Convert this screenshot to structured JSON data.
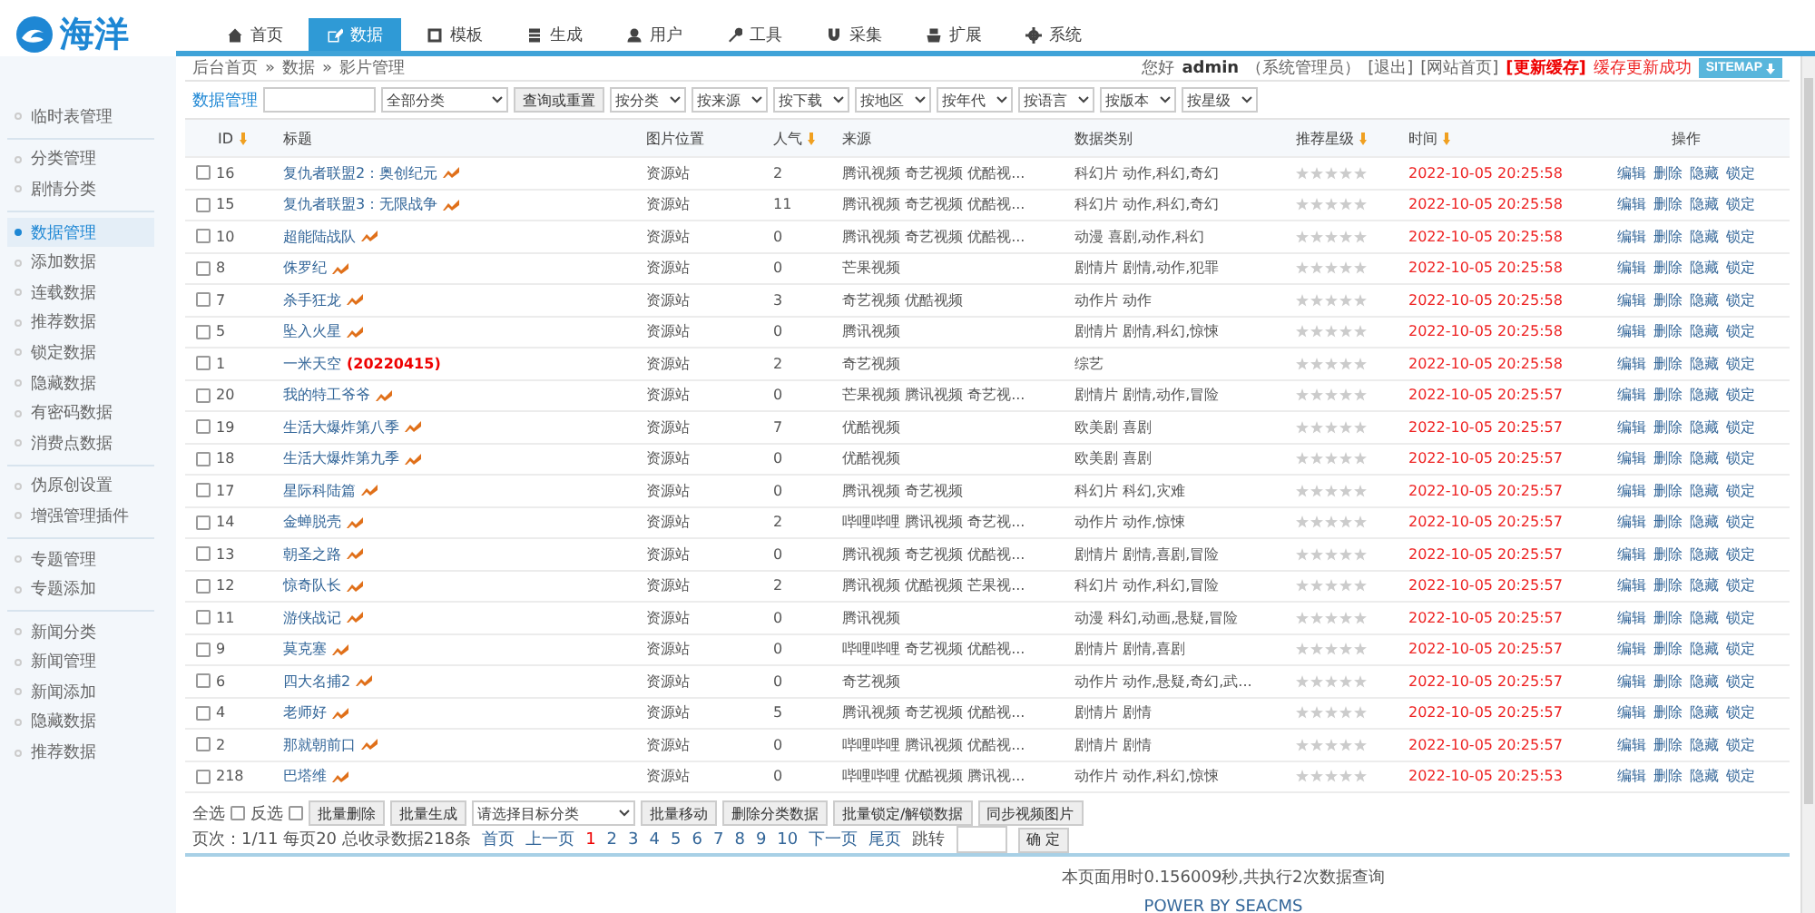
{
  "logo": {
    "text": "海洋"
  },
  "nav": [
    {
      "label": "首页",
      "selected": false
    },
    {
      "label": "数据",
      "selected": true
    },
    {
      "label": "模板",
      "selected": false
    },
    {
      "label": "生成",
      "selected": false
    },
    {
      "label": "用户",
      "selected": false
    },
    {
      "label": "工具",
      "selected": false
    },
    {
      "label": "采集",
      "selected": false
    },
    {
      "label": "扩展",
      "selected": false
    },
    {
      "label": "系统",
      "selected": false
    }
  ],
  "breadcrumb": [
    "后台首页",
    "»",
    "数据",
    "»",
    "影片管理"
  ],
  "user_bar": {
    "greeting": "您好",
    "user": "admin",
    "role": "（系统管理员）",
    "logout": "[退出]",
    "home": "[网站首页]",
    "cache": "[更新缓存]",
    "cache_status": "缓存更新成功",
    "sitemap": "SITEMAP"
  },
  "sidebar": {
    "groups": [
      {
        "items": [
          {
            "label": "临时表管理",
            "selected": false
          }
        ]
      },
      {
        "items": [
          {
            "label": "分类管理",
            "selected": false
          },
          {
            "label": "剧情分类",
            "selected": false
          }
        ]
      },
      {
        "items": [
          {
            "label": "数据管理",
            "selected": true
          },
          {
            "label": "添加数据",
            "selected": false
          },
          {
            "label": "连载数据",
            "selected": false
          },
          {
            "label": "推荐数据",
            "selected": false
          },
          {
            "label": "锁定数据",
            "selected": false
          },
          {
            "label": "隐藏数据",
            "selected": false
          },
          {
            "label": "有密码数据",
            "selected": false
          },
          {
            "label": "消费点数据",
            "selected": false
          }
        ]
      },
      {
        "items": [
          {
            "label": "伪原创设置",
            "selected": false
          },
          {
            "label": "增强管理插件",
            "selected": false
          }
        ]
      },
      {
        "items": [
          {
            "label": "专题管理",
            "selected": false
          },
          {
            "label": "专题添加",
            "selected": false
          }
        ]
      },
      {
        "items": [
          {
            "label": "新闻分类",
            "selected": false
          },
          {
            "label": "新闻管理",
            "selected": false
          },
          {
            "label": "新闻添加",
            "selected": false
          },
          {
            "label": "隐藏数据",
            "selected": false
          },
          {
            "label": "推荐数据",
            "selected": false
          }
        ]
      }
    ]
  },
  "filter": {
    "label": "数据管理",
    "category": "全部分类",
    "query_button": "查询或重置",
    "selects": [
      "按分类",
      "按来源",
      "按下载",
      "按地区",
      "按年代",
      "按语言",
      "按版本",
      "按星级"
    ]
  },
  "table": {
    "columns": [
      {
        "label": "ID",
        "sortable": true
      },
      {
        "label": "标题",
        "sortable": false
      },
      {
        "label": "图片位置",
        "sortable": false
      },
      {
        "label": "人气",
        "sortable": true
      },
      {
        "label": "来源",
        "sortable": false
      },
      {
        "label": "数据类别",
        "sortable": false
      },
      {
        "label": "推荐星级",
        "sortable": true
      },
      {
        "label": "时间",
        "sortable": true
      },
      {
        "label": "操作",
        "sortable": false
      }
    ],
    "rows": [
      {
        "checked": false,
        "id": "16",
        "title": "复仇者联盟2：奥创纪元",
        "hot": true,
        "pic": "资源站",
        "views": "2",
        "source": "腾讯视频 奇艺视频 优酷视...",
        "category": "科幻片 动作,科幻,奇幻",
        "stars": 0,
        "time": "2022-10-05 20:25:58",
        "actions": [
          "编辑",
          "删除",
          "隐藏",
          "锁定"
        ]
      },
      {
        "checked": false,
        "id": "15",
        "title": "复仇者联盟3：无限战争",
        "hot": true,
        "pic": "资源站",
        "views": "11",
        "source": "腾讯视频 奇艺视频 优酷视...",
        "category": "科幻片 动作,科幻,奇幻",
        "stars": 0,
        "time": "2022-10-05 20:25:58",
        "actions": [
          "编辑",
          "删除",
          "隐藏",
          "锁定"
        ]
      },
      {
        "checked": false,
        "id": "10",
        "title": "超能陆战队",
        "hot": true,
        "pic": "资源站",
        "views": "0",
        "source": "腾讯视频 奇艺视频 优酷视...",
        "category": "动漫 喜剧,动作,科幻",
        "stars": 0,
        "time": "2022-10-05 20:25:58",
        "actions": [
          "编辑",
          "删除",
          "隐藏",
          "锁定"
        ]
      },
      {
        "checked": false,
        "id": "8",
        "title": "侏罗纪",
        "hot": true,
        "pic": "资源站",
        "views": "0",
        "source": "芒果视频",
        "category": "剧情片 剧情,动作,犯罪",
        "stars": 0,
        "time": "2022-10-05 20:25:58",
        "actions": [
          "编辑",
          "删除",
          "隐藏",
          "锁定"
        ]
      },
      {
        "checked": false,
        "id": "7",
        "title": "杀手狂龙",
        "hot": true,
        "pic": "资源站",
        "views": "3",
        "source": "奇艺视频 优酷视频",
        "category": "动作片 动作",
        "stars": 0,
        "time": "2022-10-05 20:25:58",
        "actions": [
          "编辑",
          "删除",
          "隐藏",
          "锁定"
        ]
      },
      {
        "checked": false,
        "id": "5",
        "title": "坠入火星",
        "hot": true,
        "pic": "资源站",
        "views": "0",
        "source": "腾讯视频",
        "category": "剧情片 剧情,科幻,惊悚",
        "stars": 0,
        "time": "2022-10-05 20:25:58",
        "actions": [
          "编辑",
          "删除",
          "隐藏",
          "锁定"
        ]
      },
      {
        "checked": false,
        "id": "1",
        "title": "一米天空",
        "note": "(20220415)",
        "hot": false,
        "pic": "资源站",
        "views": "2",
        "source": "奇艺视频",
        "category": "综艺",
        "stars": 0,
        "time": "2022-10-05 20:25:58",
        "actions": [
          "编辑",
          "删除",
          "隐藏",
          "锁定"
        ]
      },
      {
        "checked": false,
        "id": "20",
        "title": "我的特工爷爷",
        "hot": true,
        "pic": "资源站",
        "views": "0",
        "source": "芒果视频 腾讯视频 奇艺视...",
        "category": "剧情片 剧情,动作,冒险",
        "stars": 0,
        "time": "2022-10-05 20:25:57",
        "actions": [
          "编辑",
          "删除",
          "隐藏",
          "锁定"
        ]
      },
      {
        "checked": false,
        "id": "19",
        "title": "生活大爆炸第八季",
        "hot": true,
        "pic": "资源站",
        "views": "7",
        "source": "优酷视频",
        "category": "欧美剧 喜剧",
        "stars": 0,
        "time": "2022-10-05 20:25:57",
        "actions": [
          "编辑",
          "删除",
          "隐藏",
          "锁定"
        ]
      },
      {
        "checked": false,
        "id": "18",
        "title": "生活大爆炸第九季",
        "hot": true,
        "pic": "资源站",
        "views": "0",
        "source": "优酷视频",
        "category": "欧美剧 喜剧",
        "stars": 0,
        "time": "2022-10-05 20:25:57",
        "actions": [
          "编辑",
          "删除",
          "隐藏",
          "锁定"
        ]
      },
      {
        "checked": false,
        "id": "17",
        "title": "星际科陆篇",
        "hot": true,
        "pic": "资源站",
        "views": "0",
        "source": "腾讯视频 奇艺视频",
        "category": "科幻片 科幻,灾难",
        "stars": 0,
        "time": "2022-10-05 20:25:57",
        "actions": [
          "编辑",
          "删除",
          "隐藏",
          "锁定"
        ]
      },
      {
        "checked": false,
        "id": "14",
        "title": "金蝉脱壳",
        "hot": true,
        "pic": "资源站",
        "views": "2",
        "source": "哔哩哔哩 腾讯视频 奇艺视...",
        "category": "动作片 动作,惊悚",
        "stars": 0,
        "time": "2022-10-05 20:25:57",
        "actions": [
          "编辑",
          "删除",
          "隐藏",
          "锁定"
        ]
      },
      {
        "checked": false,
        "id": "13",
        "title": "朝圣之路",
        "hot": true,
        "pic": "资源站",
        "views": "0",
        "source": "腾讯视频 奇艺视频 优酷视...",
        "category": "剧情片 剧情,喜剧,冒险",
        "stars": 0,
        "time": "2022-10-05 20:25:57",
        "actions": [
          "编辑",
          "删除",
          "隐藏",
          "锁定"
        ]
      },
      {
        "checked": false,
        "id": "12",
        "title": "惊奇队长",
        "hot": true,
        "pic": "资源站",
        "views": "2",
        "source": "腾讯视频 优酷视频 芒果视...",
        "category": "科幻片 动作,科幻,冒险",
        "stars": 0,
        "time": "2022-10-05 20:25:57",
        "actions": [
          "编辑",
          "删除",
          "隐藏",
          "锁定"
        ]
      },
      {
        "checked": false,
        "id": "11",
        "title": "游侠战记",
        "hot": true,
        "pic": "资源站",
        "views": "0",
        "source": "腾讯视频",
        "category": "动漫 科幻,动画,悬疑,冒险",
        "stars": 0,
        "time": "2022-10-05 20:25:57",
        "actions": [
          "编辑",
          "删除",
          "隐藏",
          "锁定"
        ]
      },
      {
        "checked": false,
        "id": "9",
        "title": "莫克塞",
        "hot": true,
        "pic": "资源站",
        "views": "0",
        "source": "哔哩哔哩 奇艺视频 优酷视...",
        "category": "剧情片 剧情,喜剧",
        "stars": 0,
        "time": "2022-10-05 20:25:57",
        "actions": [
          "编辑",
          "删除",
          "隐藏",
          "锁定"
        ]
      },
      {
        "checked": false,
        "id": "6",
        "title": "四大名捕2",
        "hot": true,
        "pic": "资源站",
        "views": "0",
        "source": "奇艺视频",
        "category": "动作片 动作,悬疑,奇幻,武...",
        "stars": 0,
        "time": "2022-10-05 20:25:57",
        "actions": [
          "编辑",
          "删除",
          "隐藏",
          "锁定"
        ]
      },
      {
        "checked": false,
        "id": "4",
        "title": "老师好",
        "hot": true,
        "pic": "资源站",
        "views": "5",
        "source": "腾讯视频 奇艺视频 优酷视...",
        "category": "剧情片 剧情",
        "stars": 0,
        "time": "2022-10-05 20:25:57",
        "actions": [
          "编辑",
          "删除",
          "隐藏",
          "锁定"
        ]
      },
      {
        "checked": false,
        "id": "2",
        "title": "那就朝前口",
        "hot": true,
        "pic": "资源站",
        "views": "0",
        "source": "哔哩哔哩 腾讯视频 优酷视...",
        "category": "剧情片 剧情",
        "stars": 0,
        "time": "2022-10-05 20:25:57",
        "actions": [
          "编辑",
          "删除",
          "隐藏",
          "锁定"
        ]
      },
      {
        "checked": false,
        "id": "218",
        "title": "巴塔维",
        "hot": true,
        "pic": "资源站",
        "views": "0",
        "source": "哔哩哔哩 优酷视频 腾讯视...",
        "category": "动作片 动作,科幻,惊悚",
        "stars": 0,
        "time": "2022-10-05 20:25:53",
        "actions": [
          "编辑",
          "删除",
          "隐藏",
          "锁定"
        ]
      }
    ]
  },
  "batch": {
    "select_all": {
      "label": "全选",
      "checked": false
    },
    "invert": {
      "label": "反选",
      "checked": false
    },
    "buttons": [
      "批量删除",
      "批量生成"
    ],
    "target": "请选择目标分类",
    "more_buttons": [
      "批量移动",
      "删除分类数据",
      "批量锁定/解锁数据",
      "同步视频图片"
    ]
  },
  "pagination": {
    "summary": "页次：1/11 每页20 总收录数据218条",
    "first": "首页",
    "prev": "上一页",
    "pages": [
      {
        "label": "1",
        "selected": true
      },
      {
        "label": "2",
        "selected": false
      },
      {
        "label": "3",
        "selected": false
      },
      {
        "label": "4",
        "selected": false
      },
      {
        "label": "5",
        "selected": false
      },
      {
        "label": "6",
        "selected": false
      },
      {
        "label": "7",
        "selected": false
      },
      {
        "label": "8",
        "selected": false
      },
      {
        "label": "9",
        "selected": false
      },
      {
        "label": "10",
        "selected": false
      }
    ],
    "next": "下一页",
    "last": "尾页",
    "jump": "跳转",
    "go": "确 定"
  },
  "footer": {
    "timing": "本页面用时0.156009秒,共执行2次数据查询",
    "powered": "POWER BY SEACMS"
  }
}
